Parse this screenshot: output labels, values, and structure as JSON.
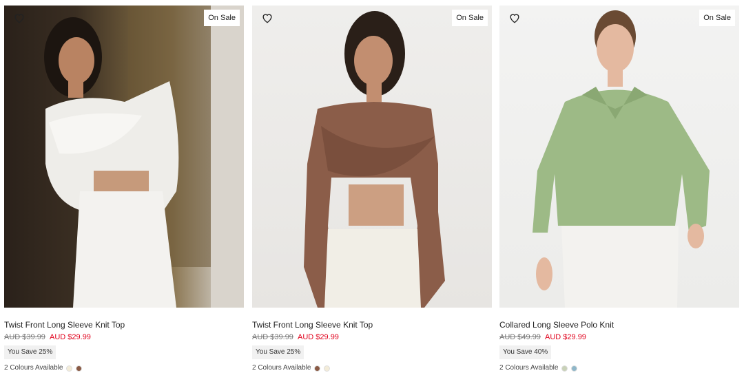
{
  "products": [
    {
      "title": "Twist Front Long Sleeve Knit Top",
      "badge": "On Sale",
      "old_price": "AUD $39.99",
      "new_price": "AUD $29.99",
      "save_text": "You Save 25%",
      "colours_text": "2 Colours Available",
      "swatches": [
        "#f3ecd9",
        "#8a5a45"
      ],
      "garment_color": "#f1f0ee"
    },
    {
      "title": "Twist Front Long Sleeve Knit Top",
      "badge": "On Sale",
      "old_price": "AUD $39.99",
      "new_price": "AUD $29.99",
      "save_text": "You Save 25%",
      "colours_text": "2 Colours Available",
      "swatches": [
        "#8a5a45",
        "#f3ecd9"
      ],
      "garment_color": "#8b5d49"
    },
    {
      "title": "Collared Long Sleeve Polo Knit",
      "badge": "On Sale",
      "old_price": "AUD $49.99",
      "new_price": "AUD $29.99",
      "save_text": "You Save 40%",
      "colours_text": "2 Colours Available",
      "swatches": [
        "#c9d2b8",
        "#8fb7c9"
      ],
      "garment_color": "#9dba86"
    }
  ],
  "icons": {
    "wishlist": "heart-outline-icon"
  },
  "colors": {
    "sale_price": "#e0001b",
    "old_price": "#777777",
    "badge_bg": "#ffffff",
    "save_bg": "#f1f1f1"
  }
}
